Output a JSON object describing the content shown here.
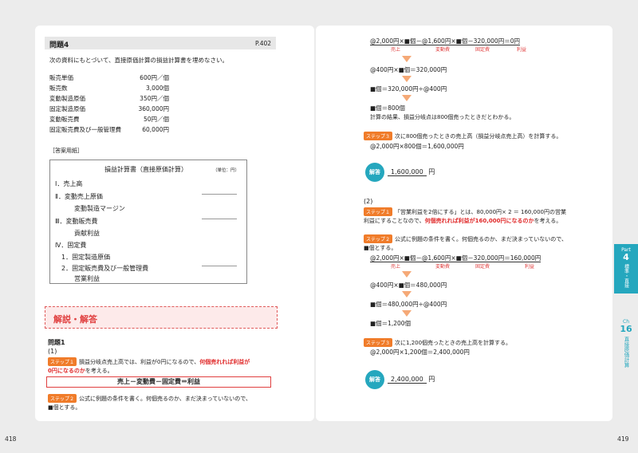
{
  "left": {
    "page_number": "418",
    "problem_title": "問題4",
    "problem_ref": "P.402",
    "instruction": "次の資料にもとづいて、直接原価計算の損益計算書を埋めなさい。",
    "data_items": [
      {
        "k": "販売単価",
        "v": "600円／個"
      },
      {
        "k": "販売数",
        "v": "3,000個"
      },
      {
        "k": "変動製造原価",
        "v": "350円／個"
      },
      {
        "k": "固定製造原価",
        "v": "360,000円"
      },
      {
        "k": "変動販売費",
        "v": "50円／個"
      },
      {
        "k": "固定販売費及び一般管理費",
        "v": "60,000円"
      }
    ],
    "answer_sheet_label": "［答案用紙］",
    "statement": {
      "title": "損益計算書（直接原価計算）",
      "unit": "（単位：円）",
      "rows": [
        "Ⅰ．売上高",
        "Ⅱ．変動売上原価",
        "変動製造マージン",
        "Ⅲ．変動販売費",
        "貢献利益",
        "Ⅳ．固定費",
        "1．固定製造原価",
        "2．固定販売費及び一般管理費",
        "営業利益"
      ]
    },
    "explanation_heading": "解説・解答",
    "answer_title": "問題1",
    "part1": "(1)",
    "step1_label": "ステップ１",
    "step1_text_a": "損益分岐点売上高では、利益が0円になるので、",
    "step1_text_red": "何個売れれば利益が",
    "step1_text_red2": "0円になるのか",
    "step1_text_b": "を考える。",
    "formula": "売上－変動費－固定費＝利益",
    "step2_label": "ステップ２",
    "step2_text": "公式に例題の条件を書く。何個売るのか、まだ決まっていないので、",
    "step2_text2": "■個とする。"
  },
  "right": {
    "page_number": "419",
    "eq1_a": "@2,000円×■個",
    "eq1_b": "－@1,600円×■個",
    "eq1_c": "－320,000円",
    "eq1_d": "＝0円",
    "sub_labels": [
      "売上",
      "変動費",
      "固定費",
      "利益"
    ],
    "s1": "@400円×■個＝320,000円",
    "s2": "■個＝320,000円÷@400円",
    "s3": "■個＝800個",
    "s3_note": "計算の結果、損益分岐点は800個売ったときだとわかる。",
    "step3_label": "ステップ３",
    "step3_text": "次に800個売ったときの売上高（損益分岐点売上高）を計算する。",
    "step3_calc": "@2,000円×800個＝1,600,000円",
    "answer_badge": "解答",
    "answer1": "1,600,000",
    "yen": "円",
    "part2": "(2)",
    "p2_step1_label": "ステップ１",
    "p2_step1_text": "「営業利益を2倍にする」とは、80,000円× 2 ＝ 160,000円の営業",
    "p2_step1_text2a": "利益にすることなので、",
    "p2_step1_red": "何個売れれば利益が160,000円になるのか",
    "p2_step1_text2b": "を考える。",
    "p2_step2_label": "ステップ２",
    "p2_step2_text": "公式に例題の条件を書く。何個売るのか、まだ決まっていないので、",
    "p2_step2_text2": "■個とする。",
    "eq2_d": "＝160,000円",
    "t1": "@400円×■個＝480,000円",
    "t2": "■個＝480,000円÷@400円",
    "t3": "■個＝1,200個",
    "p2_step3_label": "ステップ３",
    "p2_step3_text": "次に1,200個売ったときの売上高を計算する。",
    "p2_step3_calc": "@2,000円×1,200個＝2,400,000円",
    "answer2": "2,400,000"
  },
  "side": {
    "part_label": "Part",
    "part_num": "4",
    "part_title": "標準・直接",
    "ch_label": "Ch",
    "ch_num": "16",
    "ch_title": "直接原価計算"
  },
  "colors": {
    "accent": "#e04040",
    "step": "#f07c2a",
    "teal": "#25a7be"
  }
}
